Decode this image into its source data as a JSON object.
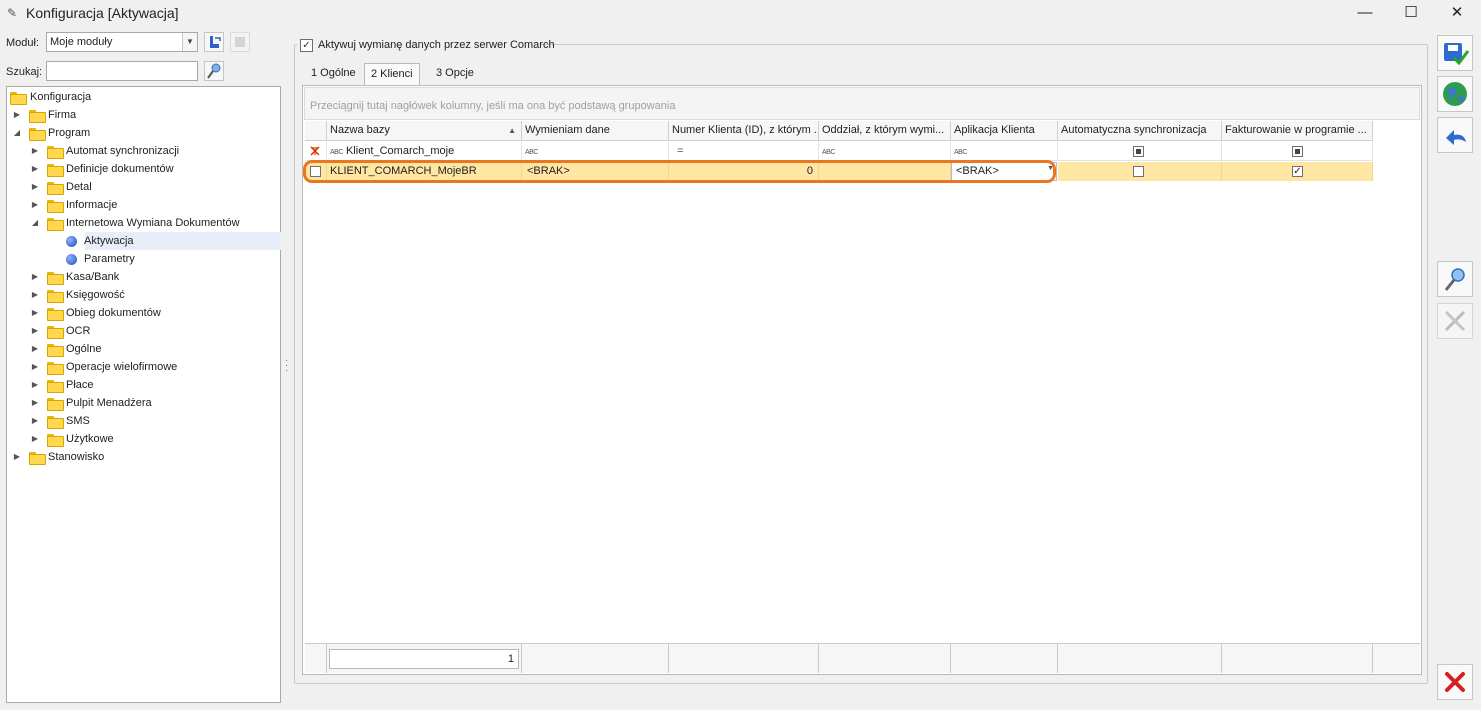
{
  "window": {
    "title": "Konfiguracja [Aktywacja]",
    "minimize": "—",
    "maximize": "☐",
    "close": "✕"
  },
  "left": {
    "module_label": "Moduł:",
    "module_value": "Moje moduły",
    "search_label": "Szukaj:",
    "search_value": ""
  },
  "tree": [
    {
      "label": "Konfiguracja"
    },
    {
      "label": "Firma"
    },
    {
      "label": "Program"
    },
    {
      "label": "Automat synchronizacji"
    },
    {
      "label": "Definicje dokumentów"
    },
    {
      "label": "Detal"
    },
    {
      "label": "Informacje"
    },
    {
      "label": "Internetowa Wymiana Dokumentów"
    },
    {
      "label": "Aktywacja"
    },
    {
      "label": "Parametry"
    },
    {
      "label": "Kasa/Bank"
    },
    {
      "label": "Księgowość"
    },
    {
      "label": "Obieg dokumentów"
    },
    {
      "label": "OCR"
    },
    {
      "label": "Ogólne"
    },
    {
      "label": "Operacje wielofirmowe"
    },
    {
      "label": "Płace"
    },
    {
      "label": "Pulpit Menadżera"
    },
    {
      "label": "SMS"
    },
    {
      "label": "Użytkowe"
    },
    {
      "label": "Stanowisko"
    }
  ],
  "main": {
    "activate_label": "Aktywuj wymianę danych przez serwer Comarch",
    "activate_checked": "✓",
    "tabs": [
      "1 Ogólne",
      "2 Klienci",
      "3 Opcje"
    ],
    "groupby_hint": "Przeciągnij tutaj nagłówek kolumny, jeśli ma ona być podstawą grupowania",
    "columns": [
      "Nazwa bazy",
      "Wymieniam dane",
      "Numer Klienta (ID), z którym ...",
      "Oddział, z którym wymi...",
      "Aplikacja Klienta",
      "Automatyczna synchronizacja",
      "Fakturowanie w programie ..."
    ],
    "filter_row": {
      "nazwa": "Klient_Comarch_moje",
      "numer_op": "="
    },
    "row": {
      "nazwa": "KLIENT_COMARCH_MojeBR",
      "wymieniam": "<BRAK>",
      "numer": "0",
      "oddzial": "",
      "aplikacja": "<BRAK>",
      "auto_sync": false,
      "fakturowanie": true
    },
    "footer_count": "1"
  },
  "colors": {
    "selected_row": "#ffe6a3",
    "highlight_outline": "#e87722",
    "close_red": "#d61f1f"
  }
}
